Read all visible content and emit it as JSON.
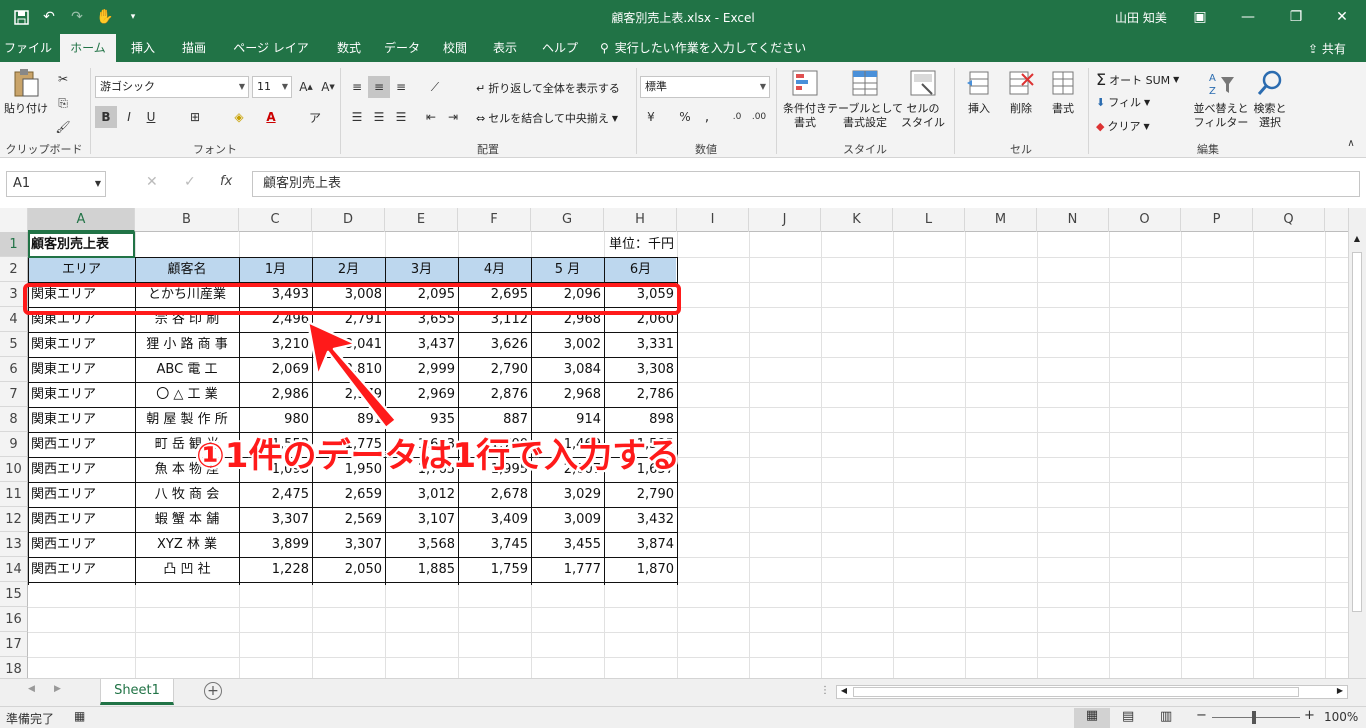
{
  "window": {
    "title": "顧客別売上表.xlsx - Excel",
    "user": "山田 知美",
    "qat": [
      "save-icon",
      "undo-icon",
      "redo-icon",
      "touch-mode-icon",
      "customize-icon"
    ]
  },
  "menu": {
    "tabs": [
      "ファイル",
      "ホーム",
      "挿入",
      "描画",
      "ページ レイアウト",
      "数式",
      "データ",
      "校閲",
      "表示",
      "ヘルプ"
    ],
    "active": "ホーム",
    "search": "実行したい作業を入力してください",
    "share": "共有"
  },
  "ribbon": {
    "clipboard": {
      "paste": "貼り付け",
      "label": "クリップボード"
    },
    "font": {
      "name": "游ゴシック",
      "size": "11",
      "label": "フォント",
      "bold": "B",
      "italic": "I",
      "underline": "U"
    },
    "alignment": {
      "wrap": "折り返して全体を表示する",
      "merge": "セルを結合して中央揃え",
      "label": "配置"
    },
    "number": {
      "format": "標準",
      "label": "数値"
    },
    "styles": {
      "cond": "条件付き\n書式",
      "table": "テーブルとして\n書式設定",
      "cellstyle": "セルの\nスタイル",
      "label": "スタイル"
    },
    "cells": {
      "insert": "挿入",
      "delete": "削除",
      "format": "書式",
      "label": "セル"
    },
    "editing": {
      "autosum": "オート SUM",
      "fill": "フィル",
      "clear": "クリア",
      "sort": "並べ替えと\nフィルター",
      "find": "検索と\n選択",
      "label": "編集"
    }
  },
  "formula_bar": {
    "name_box": "A1",
    "fx": "fx",
    "value": "顧客別売上表"
  },
  "columns": [
    "A",
    "B",
    "C",
    "D",
    "E",
    "F",
    "G",
    "H",
    "I",
    "J",
    "K",
    "L",
    "M",
    "N",
    "O",
    "P",
    "Q"
  ],
  "rows": [
    "1",
    "2",
    "3",
    "4",
    "5",
    "6",
    "7",
    "8",
    "9",
    "10",
    "11",
    "12",
    "13",
    "14",
    "15",
    "16",
    "17",
    "18"
  ],
  "sheet": {
    "title": "顧客別売上表",
    "unit": "単位：千円",
    "headers": [
      "エリア",
      "顧客名",
      "1月",
      "2月",
      "3月",
      "4月",
      "5 月",
      "6月"
    ],
    "data": [
      [
        "関東エリア",
        "とかち川産業",
        "3,493",
        "3,008",
        "2,095",
        "2,695",
        "2,096",
        "3,059"
      ],
      [
        "関東エリア",
        "宗 谷 印 刷",
        "2,496",
        "2,791",
        "3,655",
        "3,112",
        "2,968",
        "2,060"
      ],
      [
        "関東エリア",
        "狸 小 路 商 事",
        "3,210",
        "3,041",
        "3,437",
        "3,626",
        "3,002",
        "3,331"
      ],
      [
        "関東エリア",
        "ABC  電  工",
        "2,069",
        "2,810",
        "2,999",
        "2,790",
        "3,084",
        "3,308"
      ],
      [
        "関東エリア",
        "〇 △ 工  業",
        "2,986",
        "2,979",
        "2,969",
        "2,876",
        "2,968",
        "2,786"
      ],
      [
        "関東エリア",
        "朝 屋 製 作 所",
        "980",
        "891",
        "935",
        "887",
        "914",
        "898"
      ],
      [
        "関西エリア",
        "町 岳 観 光",
        "1,553",
        "1,775",
        "1,673",
        "1,700",
        "1,469",
        "1,595"
      ],
      [
        "関西エリア",
        "魚 本 物 産",
        "1,098",
        "1,950",
        "1,765",
        "1,995",
        "2,007",
        "1,657"
      ],
      [
        "関西エリア",
        "八 牧 商 会",
        "2,475",
        "2,659",
        "3,012",
        "2,678",
        "3,029",
        "2,790"
      ],
      [
        "関西エリア",
        "蝦 蟹 本 舗",
        "3,307",
        "2,569",
        "3,107",
        "3,409",
        "3,009",
        "3,432"
      ],
      [
        "関西エリア",
        "XYZ  林  業",
        "3,899",
        "3,307",
        "3,568",
        "3,745",
        "3,455",
        "3,874"
      ],
      [
        "関西エリア",
        "凸  凹  社",
        "1,228",
        "2,050",
        "1,885",
        "1,759",
        "1,777",
        "1,870"
      ]
    ]
  },
  "annotation": "①1件のデータは1行で入力する",
  "sheet_tab": "Sheet1",
  "status": {
    "ready": "準備完了",
    "zoom": "100%"
  },
  "colors": {
    "excel_green": "#217346",
    "header_fill": "#bdd7ee",
    "annotation_red": "#ff1a1a"
  }
}
